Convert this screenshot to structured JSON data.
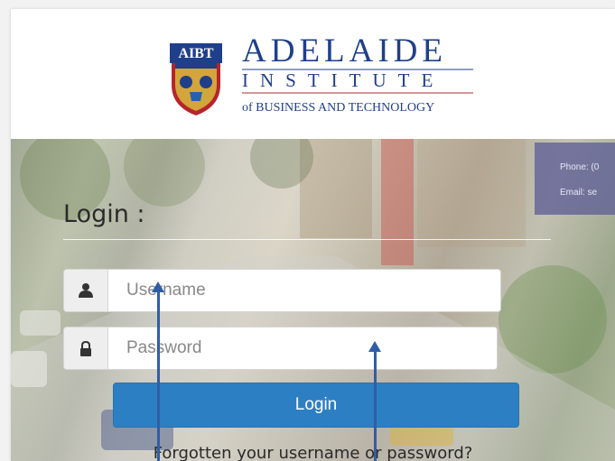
{
  "header": {
    "logo_badge": "AIBT",
    "logo_line1": "ADELAIDE",
    "logo_line2": "INSTITUTE",
    "logo_line3": "of BUSINESS AND TECHNOLOGY"
  },
  "contact": {
    "phone": "Phone: (0",
    "email": "Email:  se"
  },
  "login": {
    "title": "Login :",
    "username_placeholder": "Username",
    "password_placeholder": "Password",
    "button_label": "Login",
    "forgot_link": "Forgotten your username or password?"
  },
  "icons": {
    "username": "user-icon",
    "password": "lock-icon"
  },
  "colors": {
    "button": "#2d7fc3",
    "logo_blue": "#1f3f8a",
    "logo_red": "#b5252c",
    "arrow": "#2f5ea8"
  }
}
